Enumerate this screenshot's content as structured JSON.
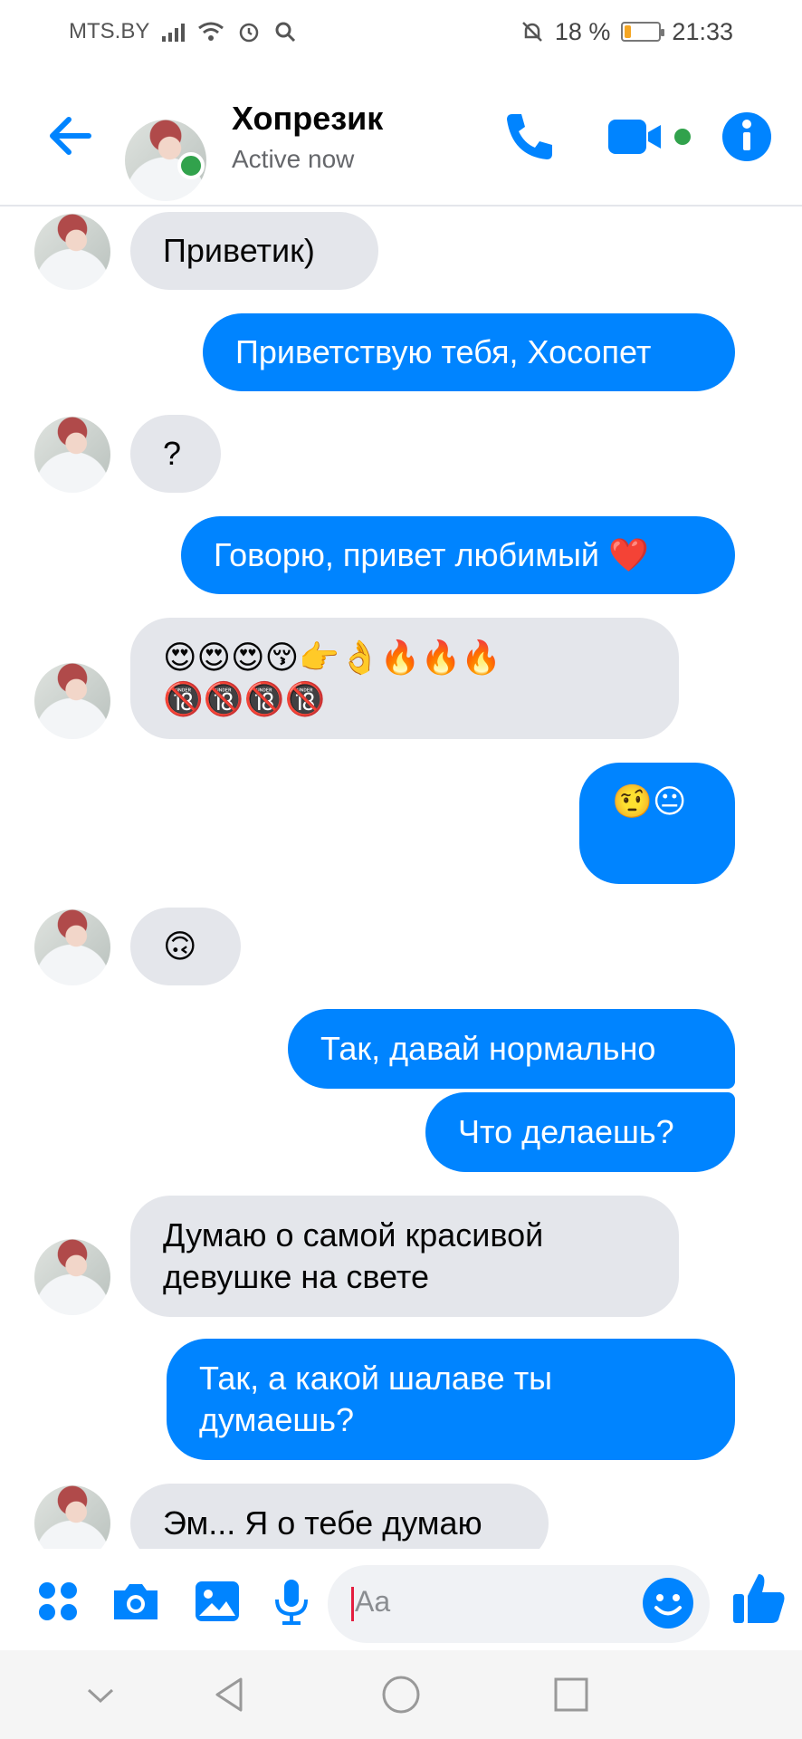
{
  "status_bar": {
    "carrier": "MTS.BY",
    "battery_percent": "18 %",
    "battery_level": 0.18,
    "time": "21:33"
  },
  "header": {
    "contact_name": "Хопрезик",
    "presence": "Active now",
    "accent_color": "#0084ff",
    "online_color": "#31a24c"
  },
  "messages": [
    {
      "side": "in",
      "text": "Приветик)",
      "avatar": true
    },
    {
      "side": "out",
      "text": "Приветствую тебя, Хосопет"
    },
    {
      "side": "in",
      "text": "?",
      "avatar": true
    },
    {
      "side": "out",
      "text": "Говорю, привет любимый",
      "emoji": "❤️"
    },
    {
      "side": "in",
      "line1": "😍😍😍😚👉👌🔥🔥🔥",
      "line2": "🔞🔞🔞🔞",
      "avatar": true
    },
    {
      "side": "out",
      "text": "🤨😐"
    },
    {
      "side": "in",
      "text": "🙃",
      "avatar": true
    },
    {
      "side": "out",
      "text": "Так, давай нормально"
    },
    {
      "side": "out",
      "text": "Что делаешь?"
    },
    {
      "side": "in",
      "line1": "Думаю о самой красивой",
      "line2": "девушке на свете",
      "avatar": true
    },
    {
      "side": "out",
      "line1": "Так, а какой шалаве ты",
      "line2": "думаешь?"
    },
    {
      "side": "in",
      "text": "Эм... Я о тебе думаю",
      "avatar": true
    }
  ],
  "composer": {
    "placeholder": "Aa",
    "icons": [
      "apps-icon",
      "camera-icon",
      "gallery-icon",
      "microphone-icon",
      "emoji-icon",
      "thumbs-up-icon"
    ]
  },
  "navigation": {
    "icons": [
      "chevron-down-icon",
      "back-triangle-icon",
      "home-circle-icon",
      "recents-square-icon"
    ]
  }
}
